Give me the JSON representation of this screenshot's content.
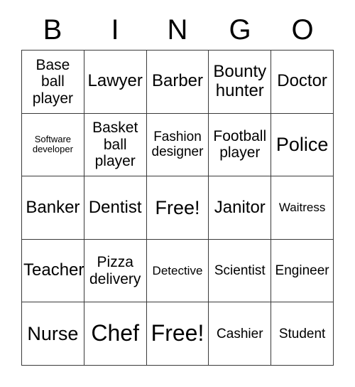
{
  "card": {
    "title": "BINGO",
    "header_letters": [
      "B",
      "I",
      "N",
      "G",
      "O"
    ],
    "border_color": "#3a3a3a",
    "background_color": "#ffffff",
    "text_color": "#000000",
    "rows": [
      [
        {
          "label": "Base\nball\nplayer",
          "size": "fs-m"
        },
        {
          "label": "Lawyer",
          "size": "fs-l"
        },
        {
          "label": "Barber",
          "size": "fs-l"
        },
        {
          "label": "Bounty\nhunter",
          "size": "fs-l"
        },
        {
          "label": "Doctor",
          "size": "fs-l"
        }
      ],
      [
        {
          "label": "Software\ndeveloper",
          "size": "fs-xs"
        },
        {
          "label": "Basket\nball\nplayer",
          "size": "fs-m"
        },
        {
          "label": "Fashion\ndesigner",
          "size": "fs-sm"
        },
        {
          "label": "Football\nplayer",
          "size": "fs-m"
        },
        {
          "label": "Police",
          "size": "fs-xl"
        }
      ],
      [
        {
          "label": "Banker",
          "size": "fs-l"
        },
        {
          "label": "Dentist",
          "size": "fs-l"
        },
        {
          "label": "Free!",
          "size": "fs-xl"
        },
        {
          "label": "Janitor",
          "size": "fs-l"
        },
        {
          "label": "Waitress",
          "size": "fs-s"
        }
      ],
      [
        {
          "label": "Teacher",
          "size": "fs-l"
        },
        {
          "label": "Pizza\ndelivery",
          "size": "fs-m"
        },
        {
          "label": "Detective",
          "size": "fs-s"
        },
        {
          "label": "Scientist",
          "size": "fs-sm"
        },
        {
          "label": "Engineer",
          "size": "fs-sm"
        }
      ],
      [
        {
          "label": "Nurse",
          "size": "fs-xl"
        },
        {
          "label": "Chef",
          "size": "fs-xxl"
        },
        {
          "label": "Free!",
          "size": "fs-xxl"
        },
        {
          "label": "Cashier",
          "size": "fs-sm"
        },
        {
          "label": "Student",
          "size": "fs-sm"
        }
      ]
    ]
  }
}
